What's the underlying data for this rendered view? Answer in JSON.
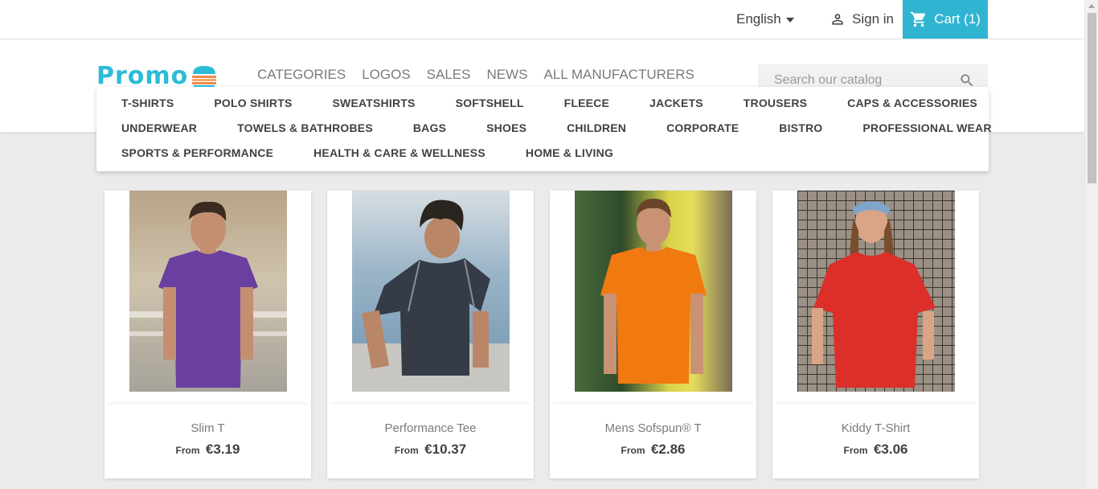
{
  "topnav": {
    "language": "English",
    "signin": "Sign in",
    "cart": "Cart (1)"
  },
  "logo": {
    "text": "Promo"
  },
  "menu": [
    "CATEGORIES",
    "LOGOS",
    "SALES",
    "NEWS",
    "ALL MANUFACTURERS"
  ],
  "search": {
    "placeholder": "Search our catalog"
  },
  "categories": {
    "row1": [
      "T-SHIRTS",
      "POLO SHIRTS",
      "SWEATSHIRTS",
      "SOFTSHELL",
      "FLEECE",
      "JACKETS",
      "TROUSERS",
      "CAPS & ACCESSORIES"
    ],
    "row2": [
      "UNDERWEAR",
      "TOWELS & BATHROBES",
      "BAGS",
      "SHOES",
      "CHILDREN",
      "CORPORATE",
      "BISTRO",
      "PROFESSIONAL WEAR"
    ],
    "row3": [
      "SPORTS & PERFORMANCE",
      "HEALTH & CARE & WELLNESS",
      "HOME & LIVING"
    ]
  },
  "products": [
    {
      "name": "Slim T",
      "from": "From",
      "price": "€3.19",
      "shirt_color": "#6a3fa0"
    },
    {
      "name": "Performance Tee",
      "from": "From",
      "price": "€10.37",
      "shirt_color": "#353c47"
    },
    {
      "name": "Mens Sofspun® T",
      "from": "From",
      "price": "€2.86",
      "shirt_color": "#f07a10"
    },
    {
      "name": "Kiddy T-Shirt",
      "from": "From",
      "price": "€3.06",
      "shirt_color": "#dc2f2a"
    }
  ],
  "colors": {
    "accent": "#2fb5d2",
    "logo": "#2bbcd6"
  }
}
